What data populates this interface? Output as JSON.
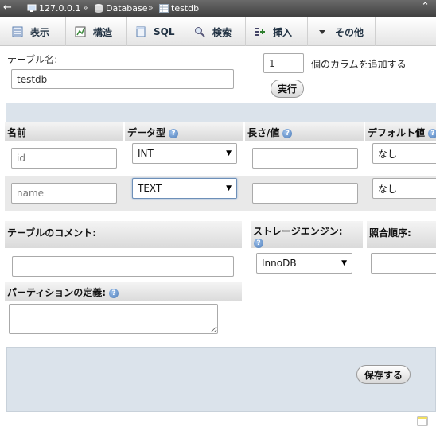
{
  "breadcrumb": {
    "back_glyph": "←",
    "server": "127.0.0.1",
    "database": "Database",
    "table": "testdb",
    "separator": "»",
    "collapse_glyph": "⌃"
  },
  "tabs": [
    {
      "label": "表示",
      "icon": "browse-icon"
    },
    {
      "label": "構造",
      "icon": "structure-icon"
    },
    {
      "label": "SQL",
      "icon": "sql-icon"
    },
    {
      "label": "検索",
      "icon": "search-icon"
    },
    {
      "label": "挿入",
      "icon": "insert-icon"
    },
    {
      "label": "その他",
      "icon": "chevron-down-icon"
    }
  ],
  "form": {
    "table_name_label": "テーブル名:",
    "table_name_value": "testdb",
    "add_columns_value": "1",
    "add_columns_label": "個のカラムを追加する",
    "execute_button": "実行"
  },
  "columns_header": {
    "name": "名前",
    "type": "データ型",
    "length": "長さ/値",
    "default": "デフォルト値"
  },
  "rows": [
    {
      "name_placeholder": "id",
      "type": "INT",
      "length": "",
      "default": "なし"
    },
    {
      "name_placeholder": "name",
      "type": "TEXT",
      "length": "",
      "default": "なし"
    }
  ],
  "bottom": {
    "comment_label": "テーブルのコメント:",
    "comment_value": "",
    "engine_label": "ストレージエンジン:",
    "engine_value": "InnoDB",
    "collation_label": "照合順序:",
    "collation_value": "",
    "partition_label": "パーティションの定義:",
    "partition_value": "",
    "save_button": "保存する"
  },
  "help_glyph": "?"
}
